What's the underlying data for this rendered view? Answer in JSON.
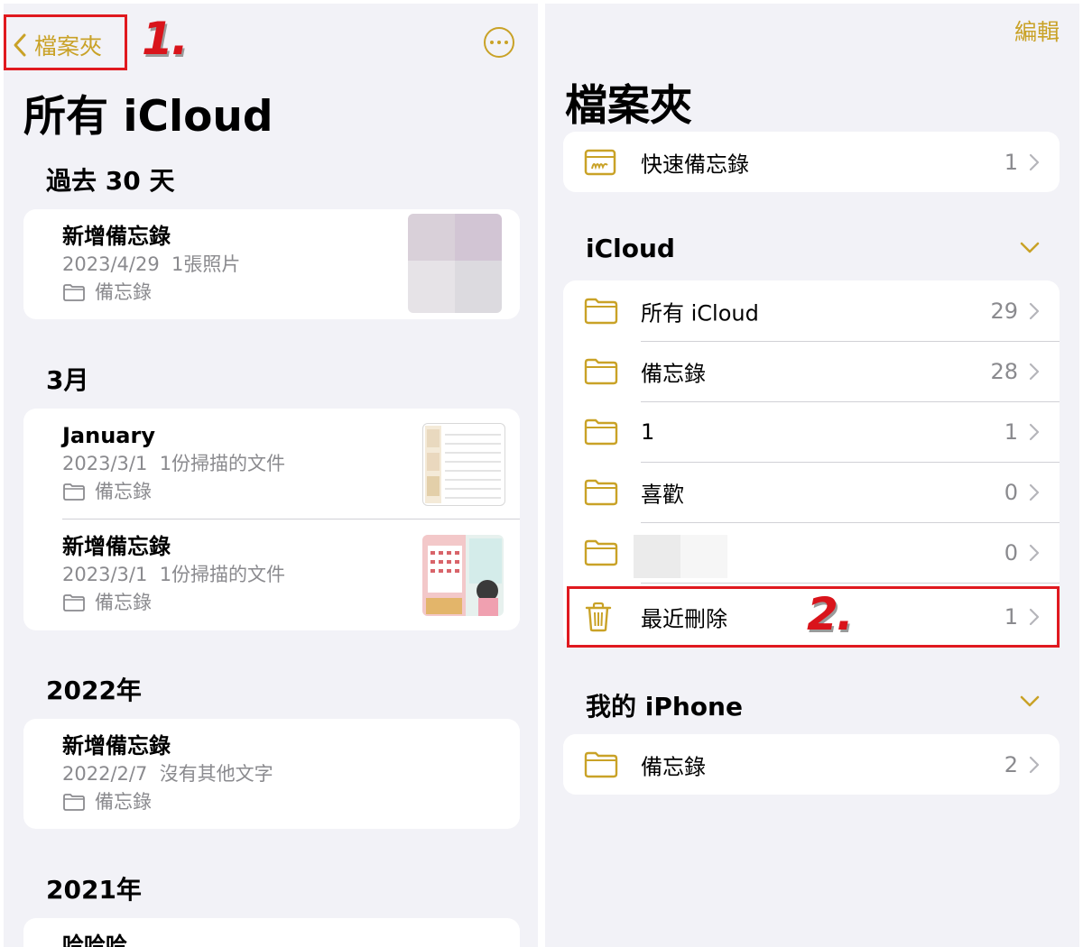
{
  "left": {
    "back_label": "檔案夾",
    "step_label": "1.",
    "title": "所有 iCloud",
    "sections": [
      {
        "title": "過去 30 天"
      },
      {
        "title": "3月"
      },
      {
        "title": "2022年"
      },
      {
        "title": "2021年"
      }
    ],
    "notes": [
      {
        "title": "新增備忘錄",
        "date": "2023/4/29",
        "preview": "1張照片",
        "folder": "備忘錄"
      },
      {
        "title": "January",
        "date": "2023/3/1",
        "preview": "1份掃描的文件",
        "folder": "備忘錄"
      },
      {
        "title": "新增備忘錄",
        "date": "2023/3/1",
        "preview": "1份掃描的文件",
        "folder": "備忘錄"
      },
      {
        "title": "新增備忘錄",
        "date": "2022/2/7",
        "preview": "沒有其他文字",
        "folder": "備忘錄"
      },
      {
        "title": "哈哈哈"
      }
    ]
  },
  "right": {
    "edit_label": "編輯",
    "title": "檔案夾",
    "step_label": "2.",
    "quick_notes": {
      "label": "快速備忘錄",
      "count": "1"
    },
    "icloud_header": "iCloud",
    "icloud_folders": [
      {
        "label": "所有 iCloud",
        "count": "29"
      },
      {
        "label": "備忘錄",
        "count": "28"
      },
      {
        "label": "1",
        "count": "1"
      },
      {
        "label": "喜歡",
        "count": "0"
      },
      {
        "label": "",
        "count": "0"
      },
      {
        "label": "最近刪除",
        "count": "1"
      }
    ],
    "iphone_header": "我的 iPhone",
    "iphone_folders": [
      {
        "label": "備忘錄",
        "count": "2"
      }
    ]
  },
  "colors": {
    "accent": "#c9a227",
    "highlight": "#e0191f",
    "background": "#f2f2f7"
  }
}
